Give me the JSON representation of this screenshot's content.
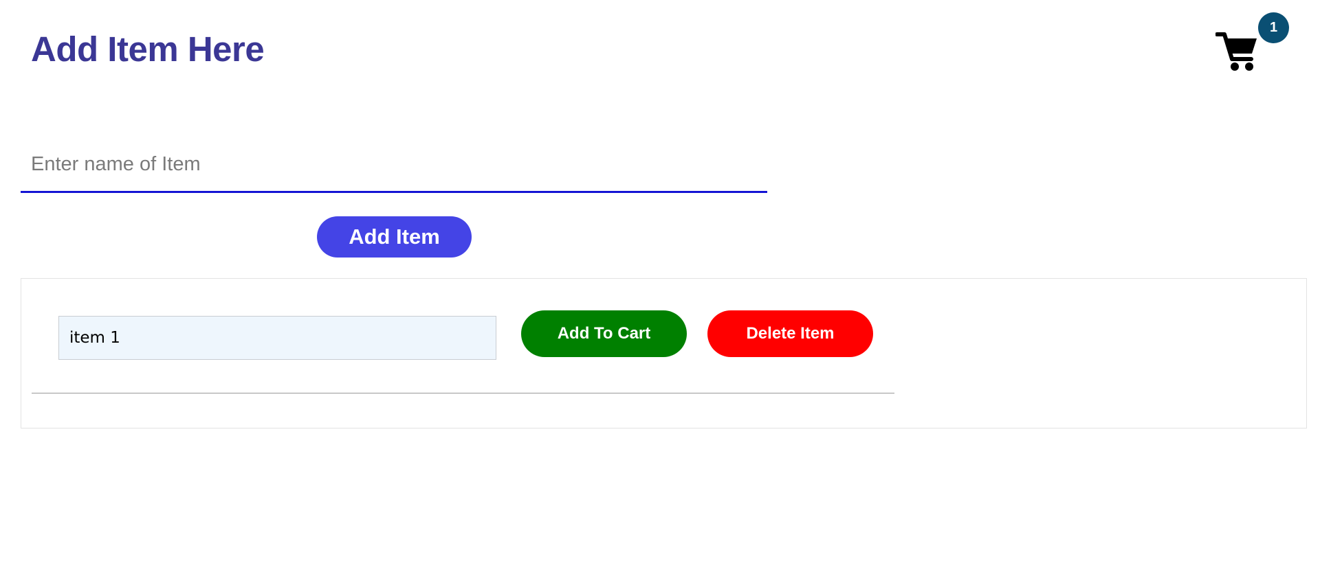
{
  "header": {
    "title": "Add Item Here"
  },
  "cart": {
    "icon": "shopping-cart-icon",
    "count": "1",
    "badge_color": "#0a4f73"
  },
  "form": {
    "input_placeholder": "Enter name of Item",
    "input_value": "",
    "add_button_label": "Add Item",
    "add_button_color": "#4444e6"
  },
  "items": [
    {
      "name": "item 1",
      "add_to_cart_label": "Add To Cart",
      "delete_label": "Delete Item"
    }
  ],
  "colors": {
    "title": "#3b3795",
    "input_underline": "#1414d4",
    "add_to_cart": "#008000",
    "delete": "#ff0000"
  }
}
